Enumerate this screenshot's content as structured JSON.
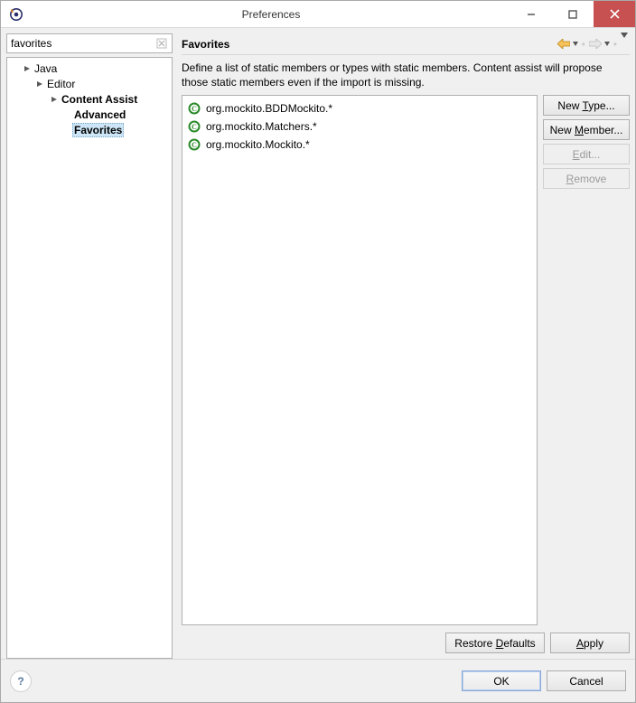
{
  "window": {
    "title": "Preferences"
  },
  "filter": {
    "value": "favorites"
  },
  "tree": {
    "items": [
      {
        "label": "Java",
        "depth": 1,
        "arrow": true
      },
      {
        "label": "Editor",
        "depth": 2,
        "arrow": true
      },
      {
        "label": "Content Assist",
        "depth": 3,
        "arrow": true,
        "bold": true
      },
      {
        "label": "Advanced",
        "depth": 4,
        "bold": true
      },
      {
        "label": "Favorites",
        "depth": 4,
        "bold": true,
        "selected": true
      }
    ]
  },
  "section": {
    "title": "Favorites",
    "description": "Define a list of static members or types with static members. Content assist will propose those static members even if the import is missing."
  },
  "favorites": [
    "org.mockito.BDDMockito.*",
    "org.mockito.Matchers.*",
    "org.mockito.Mockito.*"
  ],
  "buttons": {
    "new_type": {
      "pre": "New ",
      "mn": "T",
      "post": "ype..."
    },
    "new_member": {
      "pre": "New ",
      "mn": "M",
      "post": "ember..."
    },
    "edit": {
      "pre": "",
      "mn": "E",
      "post": "dit..."
    },
    "remove": {
      "pre": "",
      "mn": "R",
      "post": "emove"
    },
    "restore": {
      "pre": "Restore ",
      "mn": "D",
      "post": "efaults"
    },
    "apply": {
      "pre": "",
      "mn": "A",
      "post": "pply"
    },
    "ok": "OK",
    "cancel": "Cancel"
  }
}
